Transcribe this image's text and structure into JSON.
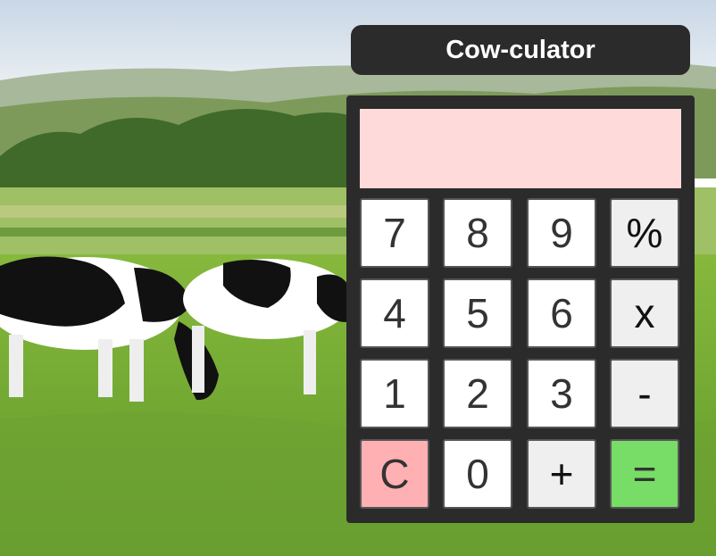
{
  "app": {
    "title": "Cow-culator"
  },
  "display": {
    "value": ""
  },
  "keypad": {
    "row1": [
      "7",
      "8",
      "9",
      "%"
    ],
    "row2": [
      "4",
      "5",
      "6",
      "x"
    ],
    "row3": [
      "1",
      "2",
      "3",
      "-"
    ],
    "row4": [
      "C",
      "0",
      "+",
      "="
    ]
  },
  "colors": {
    "panel": "#2b2b2b",
    "display": "#ffdada",
    "clear_key": "#ffb0b3",
    "equals_key": "#77dd66",
    "operator_key": "#efefef",
    "digit_key": "#ffffff"
  },
  "background": {
    "subject": "cows grazing in a green pasture"
  }
}
